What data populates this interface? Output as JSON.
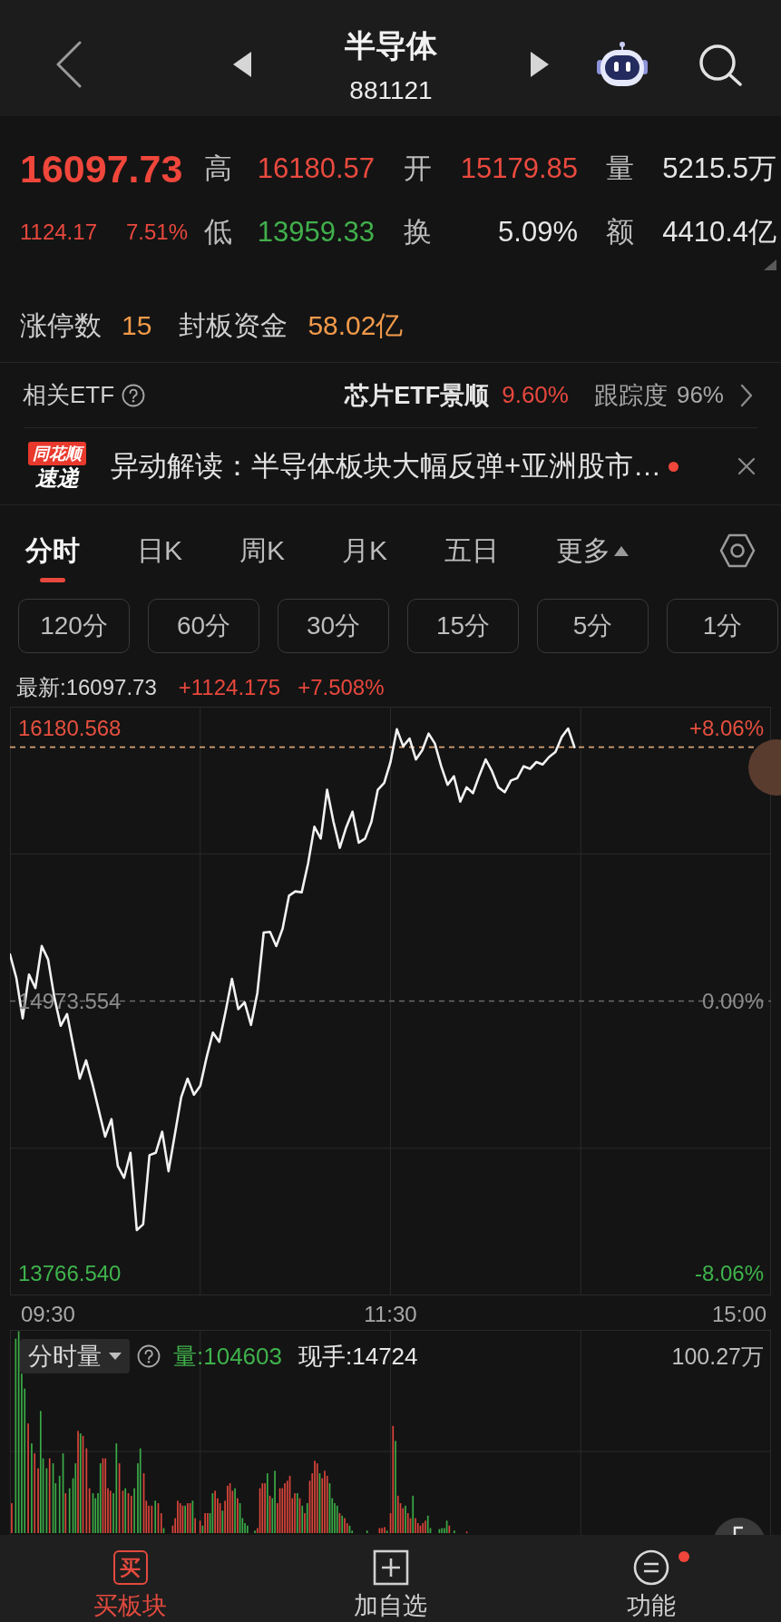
{
  "header": {
    "title": "半导体",
    "code": "881121"
  },
  "quote": {
    "price": "16097.73",
    "change": "1124.17",
    "change_pct": "7.51%",
    "fields": [
      {
        "label": "高",
        "value": "16180.57",
        "color": "#ea4a3f"
      },
      {
        "label": "开",
        "value": "15179.85",
        "color": "#ea4a3f"
      },
      {
        "label": "量",
        "value": "5215.5万",
        "color": "#e6e6e6"
      },
      {
        "label": "低",
        "value": "13959.33",
        "color": "#41b04c"
      },
      {
        "label": "换",
        "value": "5.09%",
        "color": "#e6e6e6"
      },
      {
        "label": "额",
        "value": "4410.4亿",
        "color": "#e6e6e6"
      }
    ],
    "stats": [
      {
        "label": "涨停数",
        "value": "15"
      },
      {
        "label": "封板资金",
        "value": "58.02亿"
      }
    ]
  },
  "etf": {
    "label": "相关ETF",
    "name": "芯片ETF景顺",
    "change": "9.60%",
    "tracking_label": "跟踪度",
    "tracking": "96%"
  },
  "news": {
    "brand_top": "同花顺",
    "brand_bottom": "速递",
    "text": "异动解读：半导体板块大幅反弹+亚洲股市…",
    "unread": true
  },
  "tabs": [
    {
      "label": "分时",
      "kind": "tab",
      "selected": true
    },
    {
      "label": "日K",
      "kind": "tab",
      "selected": false
    },
    {
      "label": "周K",
      "kind": "tab",
      "selected": false
    },
    {
      "label": "月K",
      "kind": "tab",
      "selected": false
    },
    {
      "label": "五日",
      "kind": "tab",
      "selected": false
    },
    {
      "label": "更多",
      "kind": "dropdown",
      "selected": false
    }
  ],
  "intervals": [
    "120分",
    "60分",
    "30分",
    "15分",
    "5分",
    "1分"
  ],
  "chart": {
    "latest": "最新:16097.73",
    "change": "+1124.175",
    "change_pct": "+7.508%",
    "pct_labels": [
      "+8.06%",
      "0.00%",
      "-8.06%"
    ],
    "chart_data": {
      "type": "line",
      "categories": [
        null,
        null,
        null,
        null,
        null,
        null,
        "09:30",
        null,
        null,
        null,
        null,
        null,
        null,
        null,
        null,
        null,
        null,
        null,
        null,
        null,
        null,
        null,
        null,
        null,
        null,
        null,
        null,
        null,
        null,
        null,
        null,
        null,
        null,
        null,
        null,
        null,
        null,
        null,
        null,
        null,
        null,
        null,
        null,
        null,
        null,
        null,
        null,
        null,
        null,
        null,
        null,
        null,
        null,
        null,
        null,
        null,
        null,
        null,
        null,
        null,
        "11:30",
        null,
        null,
        null,
        null,
        null,
        null,
        null,
        null,
        null,
        null,
        null,
        null,
        null,
        null,
        null,
        null,
        null,
        null,
        null,
        null,
        null,
        null,
        null,
        null,
        null,
        null,
        null,
        null,
        null,
        null,
        null,
        null,
        null,
        null,
        null,
        null,
        null,
        null,
        null,
        null,
        null,
        null,
        null,
        null,
        null,
        null,
        null,
        null,
        null,
        null,
        null,
        null,
        null,
        null,
        "15:00",
        null,
        null,
        null,
        null,
        null
      ],
      "series": [
        {
          "color": "#f2f2f2",
          "values": [
            15179.85,
            15076,
            14897,
            15091,
            15031,
            15217,
            15158,
            14990,
            14864,
            14916,
            14773,
            14630,
            14711,
            14607,
            14490,
            14373,
            14451,
            14243,
            14191,
            14302,
            13959.33,
            13985,
            14291,
            14302,
            14395,
            14220,
            14384,
            14548,
            14630,
            14559,
            14598,
            14723,
            14834,
            14793,
            14927,
            15072,
            14938,
            14968,
            14868,
            15009,
            15277,
            15280,
            15217,
            15295,
            15440,
            15459,
            15455,
            15582,
            15745,
            15693,
            15909,
            15768,
            15652,
            15742,
            15812,
            15675,
            15693,
            15768,
            15909,
            15939,
            16032,
            16177,
            16102,
            16136,
            16043,
            16084,
            16158,
            16114,
            16013,
            15931,
            15969,
            15857,
            15920,
            15894,
            15972,
            16043,
            15991,
            15920,
            15898,
            15950,
            15961,
            16013,
            16002,
            16032,
            16021,
            16054,
            16076,
            16143,
            16180.57,
            16097.73,
            null,
            null,
            null,
            null,
            null,
            null,
            null,
            null,
            null,
            null,
            null,
            null,
            null,
            null,
            null,
            null,
            null,
            null,
            null,
            null,
            null,
            null,
            null,
            null,
            null,
            null,
            null,
            null,
            null,
            null,
            null
          ]
        }
      ],
      "ylim": [
        13670.14,
        16276.97
      ],
      "yticks": [
        {
          "value": 13766.54,
          "label": "13766.540"
        },
        {
          "value": 14973.554,
          "label": "14973.554"
        },
        {
          "value": 16180.568,
          "label": "16180.568"
        }
      ],
      "ref_lines": [
        {
          "axis": "y",
          "value": 14973.554,
          "color": "#6a6a6a"
        },
        {
          "axis": "y",
          "value": 16097.73,
          "color": "#d6a274"
        }
      ]
    }
  },
  "volume": {
    "selector": "分时量",
    "volume": "量:104603",
    "current": "现手:14724",
    "max": "100.27万"
  },
  "nav": [
    {
      "kind": "buy",
      "icon_text": "买",
      "label": "买板块",
      "badge": false
    },
    {
      "kind": "add",
      "label": "加自选",
      "badge": false
    },
    {
      "kind": "menu",
      "label": "功能",
      "badge": true
    }
  ]
}
